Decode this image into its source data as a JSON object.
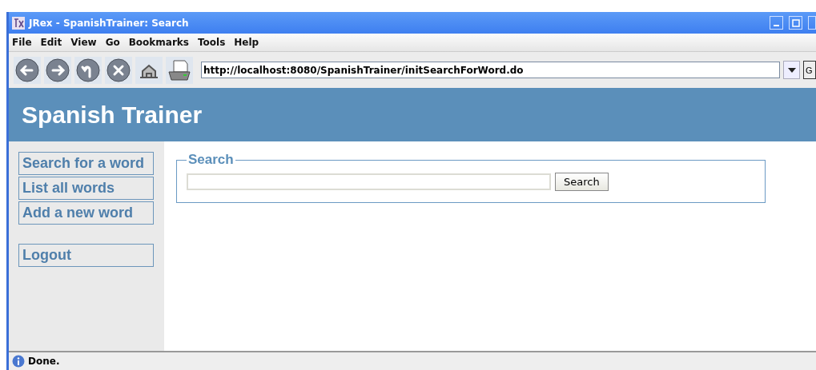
{
  "window": {
    "title": "JRex - SpanishTrainer: Search"
  },
  "menu": [
    "File",
    "Edit",
    "View",
    "Go",
    "Bookmarks",
    "Tools",
    "Help"
  ],
  "toolbar": {
    "address": "http://localhost:8080/SpanishTrainer/initSearchForWord.do",
    "go_button": "G"
  },
  "page": {
    "heading": "Spanish Trainer",
    "nav_groups": [
      {
        "links": [
          "Search for a word",
          "List all words",
          "Add a new word"
        ]
      },
      {
        "links": [
          "Logout"
        ]
      }
    ],
    "search": {
      "legend": "Search",
      "button": "Search"
    }
  },
  "status_bar": "Done."
}
